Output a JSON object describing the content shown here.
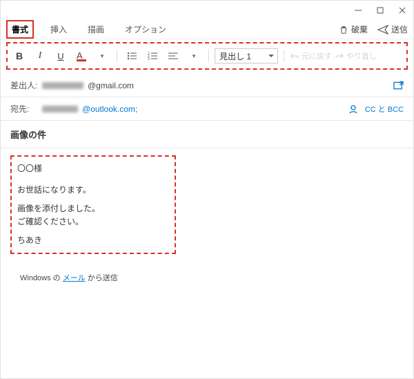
{
  "window_controls": {
    "min": "min",
    "max": "max",
    "close": "close"
  },
  "tabs": {
    "format": "書式",
    "insert": "挿入",
    "draw": "描画",
    "option": "オプション"
  },
  "actions": {
    "discard": "破棄",
    "send": "送信"
  },
  "toolbar": {
    "heading_value": "見出し 1",
    "undo_label": "元に戻す",
    "redo_label": "やり直し"
  },
  "from": {
    "label": "差出人:",
    "domain": "@gmail.com"
  },
  "to": {
    "label": "宛先:",
    "domain": "@outlook.com;",
    "cc_bcc": "CC と BCC"
  },
  "subject": "画像の件",
  "body": {
    "l1": "〇〇様",
    "l2": "お世話になります。",
    "l3": "画像を添付しました。",
    "l4": "ご確認ください。",
    "l5": "ちあき"
  },
  "signature": {
    "prefix": "Windows の ",
    "link": "メール",
    "suffix": " から送信"
  }
}
